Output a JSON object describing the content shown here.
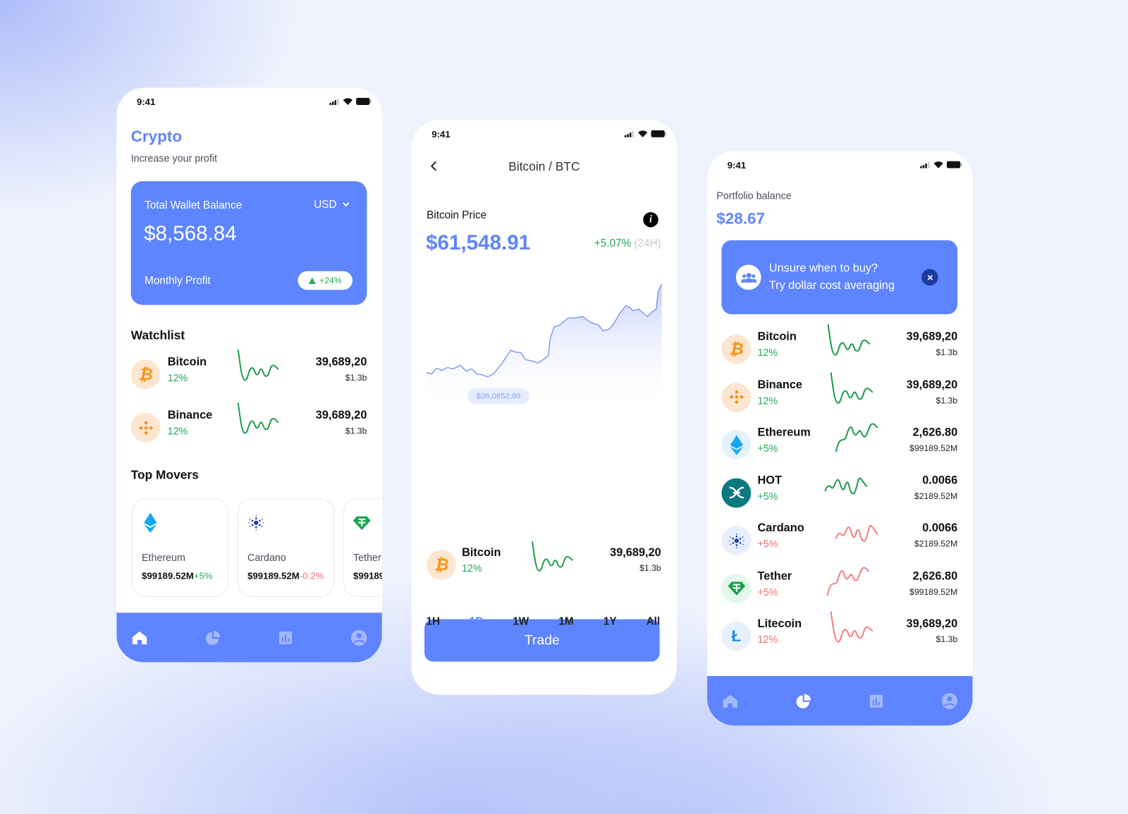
{
  "colors": {
    "accent": "#5e84ff",
    "positive": "#27a85a",
    "negative": "#f36e6e",
    "dark_navy": "#1f3aa0"
  },
  "status_bar": {
    "time": "9:41"
  },
  "home": {
    "title": "Crypto",
    "subtitle": "Increase your profit",
    "wallet": {
      "label": "Total Wallet Balance",
      "currency": "USD",
      "balance": "$8,568.84",
      "profit_label": "Monthly Profit",
      "profit_badge": "+24%"
    },
    "watchlist_title": "Watchlist",
    "watchlist": [
      {
        "name": "Bitcoin",
        "pct": "12%",
        "price": "39,689,20",
        "cap": "$1.3b",
        "icon": "bitcoin-icon",
        "trend": "positive"
      },
      {
        "name": "Binance",
        "pct": "12%",
        "price": "39,689,20",
        "cap": "$1.3b",
        "icon": "binance-icon",
        "trend": "positive"
      }
    ],
    "top_movers_title": "Top Movers",
    "top_movers": [
      {
        "name": "Ethereum",
        "value": "$99189.52M",
        "change": "+5%",
        "icon": "ethereum-icon",
        "trend": "positive"
      },
      {
        "name": "Cardano",
        "value": "$99189.52M",
        "change": "-0.2%",
        "icon": "cardano-icon",
        "trend": "negative"
      },
      {
        "name": "Tether",
        "value": "$99189",
        "icon": "tether-icon"
      }
    ],
    "nav": {
      "active": "home",
      "items": [
        "home-icon",
        "portfolio-pie-icon",
        "stats-bar-icon",
        "profile-icon"
      ]
    }
  },
  "detail": {
    "title": "Bitcoin / BTC",
    "price_label": "Bitcoin Price",
    "price": "$61,548.91",
    "change": "+5.07%",
    "change_period": "(24H)",
    "chart_tooltip": "$36,0652.99",
    "ranges": [
      "1H",
      "1D",
      "1W",
      "1M",
      "1Y",
      "All"
    ],
    "active_range": "1D",
    "coin": {
      "name": "Bitcoin",
      "pct": "12%",
      "price": "39,689,20",
      "cap": "$1.3b",
      "icon": "bitcoin-icon",
      "trend": "positive"
    },
    "trade_label": "Trade"
  },
  "portfolio": {
    "label": "Portfolio balance",
    "balance": "$28.67",
    "banner": {
      "line1": "Unsure when to buy?",
      "line2": "Try dollar cost averaging"
    },
    "coins": [
      {
        "name": "Bitcoin",
        "pct": "12%",
        "price": "39,689,20",
        "cap": "$1.3b",
        "icon": "bitcoin-icon",
        "trend": "positive"
      },
      {
        "name": "Binance",
        "pct": "12%",
        "price": "39,689,20",
        "cap": "$1.3b",
        "icon": "binance-icon",
        "trend": "positive"
      },
      {
        "name": "Ethereum",
        "pct": "+5%",
        "price": "2,626.80",
        "cap": "$99189.52M",
        "icon": "ethereum-icon",
        "trend": "positive"
      },
      {
        "name": "HOT",
        "pct": "+5%",
        "price": "0.0066",
        "cap": "$2189.52M",
        "icon": "hot-icon",
        "trend": "positive"
      },
      {
        "name": "Cardano",
        "pct": "+5%",
        "price": "0.0066",
        "cap": "$2189.52M",
        "icon": "cardano-icon",
        "trend": "negative"
      },
      {
        "name": "Tether",
        "pct": "+5%",
        "price": "2,626.80",
        "cap": "$99189.52M",
        "icon": "tether-icon",
        "trend": "negative"
      },
      {
        "name": "Litecoin",
        "pct": "12%",
        "price": "39,689,20",
        "cap": "$1.3b",
        "icon": "litecoin-icon",
        "trend": "negative"
      }
    ],
    "nav": {
      "active": "portfolio"
    }
  }
}
